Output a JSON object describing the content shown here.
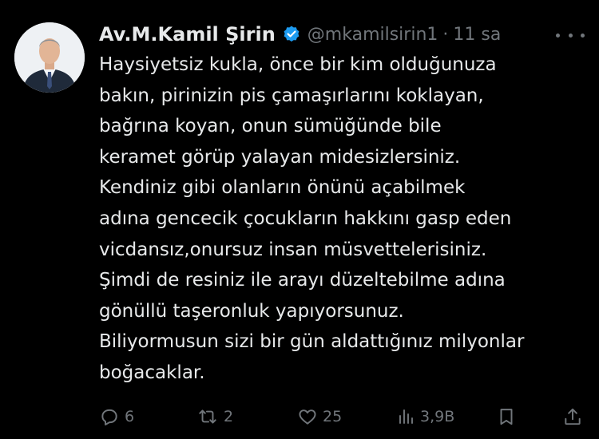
{
  "colors": {
    "background": "#000000",
    "text": "#e7e9ea",
    "secondary": "#71767b",
    "verified": "#1d9bf0"
  },
  "tweet": {
    "author_name": "Av.M.Kamil Şirin",
    "handle": "@mkamilsirin1",
    "separator": "·",
    "time": "11 sa",
    "lines": [
      "Haysiyetsiz kukla,  önce bir kim olduğunuza",
      "bakın, pirinizin pis çamaşırlarını koklayan,",
      "bağrına koyan, onun sümüğünde bile",
      "keramet görüp yalayan midesizlersiniz.",
      "Kendiniz gibi olanların önünü açabilmek",
      "adına gencecik çocukların hakkını gasp eden",
      "vicdansız,onursuz insan müsvettelerisiniz.",
      "Şimdi de resiniz ile arayı düzeltebilme adına",
      "gönüllü taşeronluk yapıyorsunuz.",
      "Biliyormusun sizi bir gün aldattığınız milyonlar",
      "boğacaklar."
    ]
  },
  "actions": {
    "reply": {
      "icon": "reply-icon",
      "count": "6"
    },
    "retweet": {
      "icon": "retweet-icon",
      "count": "2"
    },
    "like": {
      "icon": "heart-icon",
      "count": "25"
    },
    "views": {
      "icon": "views-icon",
      "count": "3,9B"
    },
    "bookmark": {
      "icon": "bookmark-icon"
    },
    "share": {
      "icon": "share-icon"
    }
  }
}
